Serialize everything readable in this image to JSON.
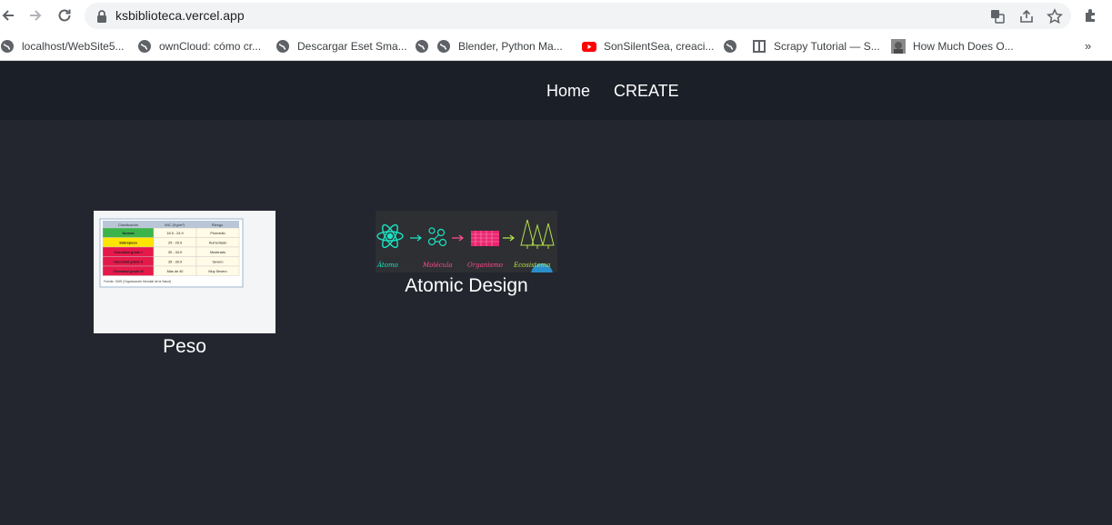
{
  "browser": {
    "url": "ksbiblioteca.vercel.app",
    "bookmarks": [
      {
        "label": "localhost/WebSite5...",
        "icon": "globe-icon"
      },
      {
        "label": "ownCloud: cómo cr...",
        "icon": "globe-icon"
      },
      {
        "label": "Descargar Eset Sma...",
        "icon": "globe-icon"
      },
      {
        "label": "Blender, Python Ma...",
        "icon": "globe-icon"
      },
      {
        "label": "SonSilentSea, creaci...",
        "icon": "youtube-icon"
      },
      {
        "label": "",
        "icon": "globe-icon"
      },
      {
        "label": "Scrapy Tutorial — S...",
        "icon": "book-icon"
      },
      {
        "label": "How Much Does O...",
        "icon": "photo-icon"
      }
    ],
    "more_label": "»"
  },
  "nav": {
    "home": "Home",
    "create": "CREATE"
  },
  "cards": [
    {
      "title": "Peso",
      "thumb": {
        "headers": [
          "Clasificación",
          "IMC (Kg/m²)",
          "Riesgo"
        ],
        "rows": [
          {
            "c": "Normal",
            "v": "18.5 - 24.9",
            "r": "Promedio",
            "color": "#3cb44b"
          },
          {
            "c": "Sobrepeso",
            "v": "25 - 29.9",
            "r": "Aumentado",
            "color": "#ffe600"
          },
          {
            "c": "Obesidad grado I",
            "v": "30 - 34.9",
            "r": "Moderado",
            "color": "#e6194b"
          },
          {
            "c": "Obesidad grado II",
            "v": "35 - 39.9",
            "r": "Severo",
            "color": "#e6194b"
          },
          {
            "c": "Obesidad grado III",
            "v": "Más de 40",
            "r": "Muy Severo",
            "color": "#e6194b"
          }
        ],
        "footnote": "Fuente: OMS (Organización Mundial de la Salud)"
      }
    },
    {
      "title": "Atomic Design",
      "thumb": {
        "labels": [
          "Átomo",
          "Molécula",
          "Organismo",
          "Ecosistema"
        ]
      }
    }
  ],
  "colors": {
    "header_bg": "#1b1f27",
    "page_bg": "#23262e",
    "text": "#ffffff"
  }
}
